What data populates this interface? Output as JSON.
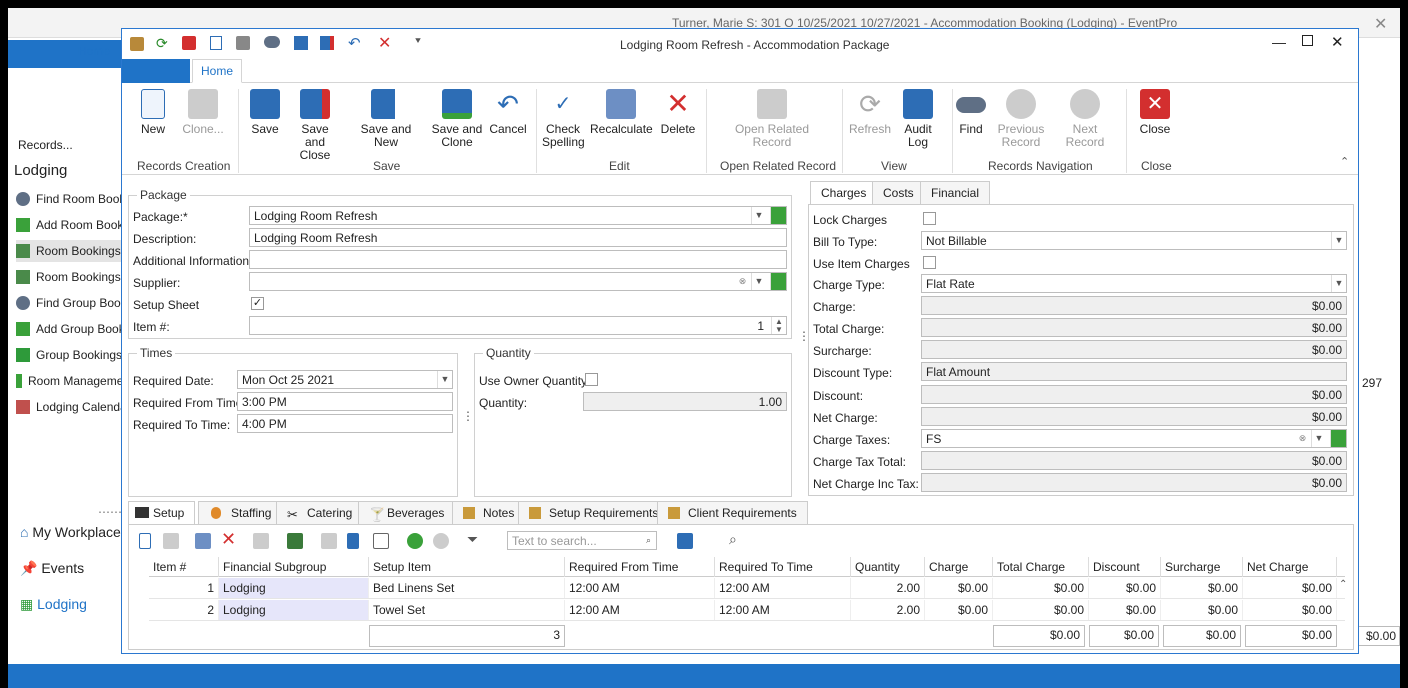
{
  "back": {
    "title": "Turner, Marie S: 301 O 10/25/2021 10/27/2021  - Accommodation Booking (Lodging) - EventPro",
    "home_tab": "Home",
    "records_label": "Records...",
    "section": "Lodging",
    "side_items": [
      "Find Room Bookings",
      "Add Room Bookings",
      "Room Bookings",
      "Room Bookings by",
      "Find Group Bookings",
      "Add Group Bookings",
      "Group Bookings",
      "Room Management",
      "Lodging Calendar"
    ],
    "nav": [
      "My Workplace",
      "Events",
      "Lodging"
    ],
    "right_value": "297",
    "right_total": "$0.00"
  },
  "window": {
    "title": "Lodging Room Refresh - Accommodation Package",
    "home_tab": "Home"
  },
  "ribbon": {
    "groups": [
      "Records Creation",
      "Save",
      "Edit",
      "Open Related Record",
      "View",
      "Records Navigation",
      "Close"
    ],
    "buttons": {
      "new": "New",
      "clone": "Clone...",
      "save": "Save",
      "save_close": "Save and Close",
      "save_new": "Save and New",
      "save_clone": "Save and Clone",
      "cancel": "Cancel",
      "check_spelling": "Check Spelling",
      "recalculate": "Recalculate",
      "delete": "Delete",
      "open_related": "Open Related Record",
      "refresh": "Refresh",
      "audit_log": "Audit Log",
      "find": "Find",
      "previous": "Previous Record",
      "next": "Next Record",
      "close": "Close"
    }
  },
  "package": {
    "legend": "Package",
    "package_label": "Package:*",
    "package_value": "Lodging Room Refresh",
    "description_label": "Description:",
    "description_value": "Lodging Room Refresh",
    "additional_label": "Additional Information:",
    "additional_value": "",
    "supplier_label": "Supplier:",
    "supplier_value": "",
    "setup_sheet_label": "Setup Sheet",
    "setup_sheet_checked": true,
    "item_label": "Item #:",
    "item_value": "1"
  },
  "times": {
    "legend": "Times",
    "date_label": "Required Date:",
    "date_value": "Mon Oct 25 2021",
    "from_label": "Required From Time:",
    "from_value": "3:00 PM",
    "to_label": "Required To Time:",
    "to_value": "4:00 PM"
  },
  "quantity": {
    "legend": "Quantity",
    "owner_label": "Use Owner Quantity",
    "owner_checked": false,
    "qty_label": "Quantity:",
    "qty_value": "1.00"
  },
  "charges_tabs": [
    "Charges",
    "Costs",
    "Financial"
  ],
  "charges": {
    "lock_label": "Lock Charges",
    "bill_label": "Bill To Type:",
    "bill_value": "Not Billable",
    "use_item_label": "Use Item Charges",
    "charge_type_label": "Charge Type:",
    "charge_type_value": "Flat Rate",
    "charge_label": "Charge:",
    "charge_value": "$0.00",
    "total_label": "Total Charge:",
    "total_value": "$0.00",
    "surcharge_label": "Surcharge:",
    "surcharge_value": "$0.00",
    "discount_type_label": "Discount Type:",
    "discount_type_value": "Flat Amount",
    "discount_label": "Discount:",
    "discount_value": "$0.00",
    "net_label": "Net Charge:",
    "net_value": "$0.00",
    "taxes_label": "Charge Taxes:",
    "taxes_value": "FS",
    "tax_total_label": "Charge Tax Total:",
    "tax_total_value": "$0.00",
    "net_inc_label": "Net Charge Inc Tax:",
    "net_inc_value": "$0.00"
  },
  "bottom_tabs": [
    "Setup",
    "Staffing",
    "Catering",
    "Beverages",
    "Notes",
    "Setup Requirements",
    "Client Requirements"
  ],
  "grid": {
    "search_placeholder": "Text to search...",
    "columns": [
      "Item #",
      "Financial Subgroup",
      "Setup Item",
      "Required From Time",
      "Required To Time",
      "Quantity",
      "Charge",
      "Total Charge",
      "Discount",
      "Surcharge",
      "Net Charge"
    ],
    "rows": [
      [
        "1",
        "Lodging",
        "Bed Linens Set",
        "12:00 AM",
        "12:00 AM",
        "2.00",
        "$0.00",
        "$0.00",
        "$0.00",
        "$0.00",
        "$0.00"
      ],
      [
        "2",
        "Lodging",
        "Towel Set",
        "12:00 AM",
        "12:00 AM",
        "2.00",
        "$0.00",
        "$0.00",
        "$0.00",
        "$0.00",
        "$0.00"
      ]
    ],
    "footer": {
      "count": "3",
      "total_charge": "$0.00",
      "discount": "$0.00",
      "surcharge": "$0.00",
      "net_charge": "$0.00"
    }
  },
  "colors": {
    "accent": "#1f73c7",
    "delete_red": "#d32f2f",
    "save_blue": "#2d6db5"
  }
}
